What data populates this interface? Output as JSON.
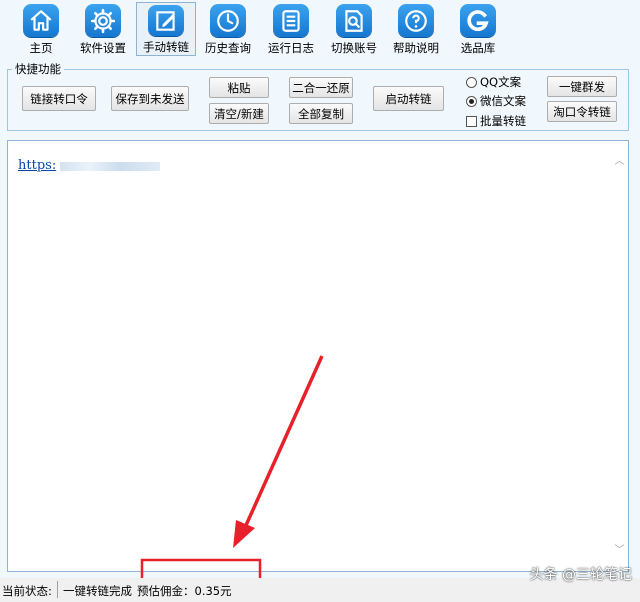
{
  "toolbar": {
    "items": [
      {
        "label": "主页",
        "icon": "home-icon"
      },
      {
        "label": "软件设置",
        "icon": "gear-icon"
      },
      {
        "label": "手动转链",
        "icon": "edit-icon"
      },
      {
        "label": "历史查询",
        "icon": "clock-icon"
      },
      {
        "label": "运行日志",
        "icon": "list-icon"
      },
      {
        "label": "切换账号",
        "icon": "search-doc-icon"
      },
      {
        "label": "帮助说明",
        "icon": "help-icon"
      },
      {
        "label": "选品库",
        "icon": "g-logo-icon"
      }
    ]
  },
  "quick": {
    "title": "快捷功能",
    "btn_link_token": "链接转口令",
    "btn_save_unsent": "保存到未发送",
    "btn_paste": "粘贴",
    "btn_clear_new": "清空/新建",
    "btn_two_in_one": "二合一还原",
    "btn_copy_all": "全部复制",
    "btn_start": "启动转链",
    "radio_qq": "QQ文案",
    "radio_wechat": "微信文案",
    "check_batch": "批量转链",
    "btn_one_click": "一键群发",
    "btn_taokouling": "淘口令转链"
  },
  "editor": {
    "link_text": "https:"
  },
  "status": {
    "label": "当前状态:",
    "state": "一键转链完成",
    "commission": "预估佣金：0.35元"
  },
  "watermark": "头条 @三轮笔记",
  "colors": {
    "icon_blue": "#1e88e5",
    "highlight_red": "#e8202a"
  }
}
